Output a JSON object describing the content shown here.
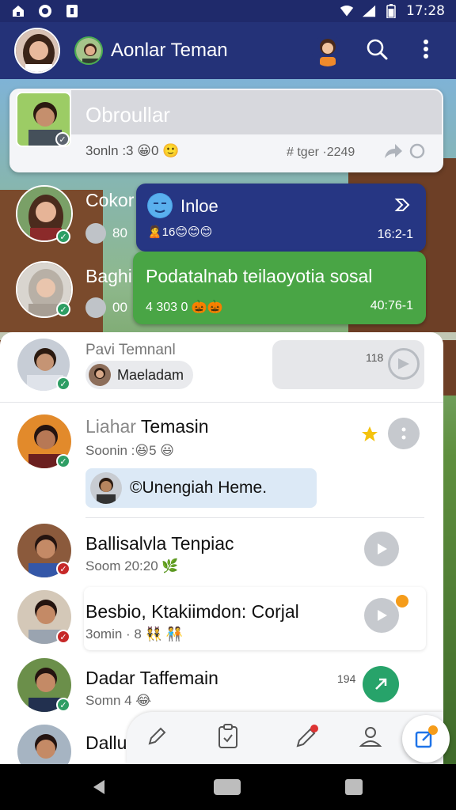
{
  "status_bar": {
    "time": "17:28"
  },
  "app_bar": {
    "title": "Aonlar Teman"
  },
  "chats": [
    {
      "name": "Obroullar",
      "preview": "3onln :3 😀0 🙂",
      "meta": "# tger ·2249"
    },
    {
      "name": "Cokor",
      "preview": "80",
      "badge": "check"
    },
    {
      "name": "Baghi",
      "preview": "00",
      "badge": "check"
    },
    {
      "name": "Pavi Temnanl",
      "chip": "Maeladam",
      "count": "118"
    },
    {
      "name_gray": "Liahar",
      "name_dark": "Temasin",
      "preview": "Soonin :😆5 😃",
      "quoted": "©Unengiah Heme."
    },
    {
      "name": "Ballisalvla Tenpiac",
      "preview": "Soom 20:20 🌿"
    },
    {
      "name": "Besbio, Ktakiimdon: Corjal",
      "preview": "3omin · 8 👯 🧑‍🤝‍🧑"
    },
    {
      "name": "Dadar Taffemain",
      "preview": "Somn 4 😂",
      "count": "194"
    },
    {
      "name": "Dallu"
    }
  ],
  "bubbles": {
    "blue": {
      "title": "Inloe",
      "emojis": "🙎16😊😊😊",
      "time": "16:2-1"
    },
    "green": {
      "title": "Podatalnab teilaoyotia sosal",
      "meta": "4 303 0 🎃🎃",
      "time": "40:76-1"
    }
  },
  "colors": {
    "primary": "#243278",
    "accent_green": "#49a545",
    "online": "#2e9e64"
  },
  "icons": [
    "home-lock-icon",
    "whatsapp-icon",
    "notification-icon",
    "wifi-icon",
    "signal-icon",
    "battery-icon",
    "search-icon",
    "more-vert-icon",
    "forward-icon",
    "share-icon",
    "star-icon",
    "play-icon",
    "edit-icon",
    "clipboard-icon",
    "pen-icon",
    "profile-icon",
    "new-chat-icon"
  ]
}
